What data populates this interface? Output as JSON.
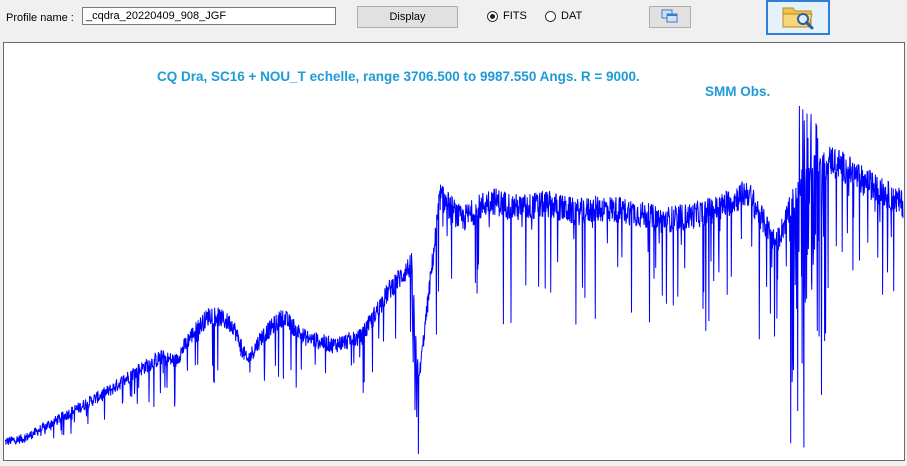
{
  "form": {
    "profile_label": "Profile name :",
    "profile_value": "_cqdra_20220409_908_JGF",
    "display_label": "Display",
    "format_options": [
      {
        "label": "FITS",
        "selected": true
      },
      {
        "label": "DAT",
        "selected": false
      }
    ]
  },
  "icons": {
    "copy": "copy-windows-icon",
    "open": "folder-magnifier-icon"
  },
  "colors": {
    "spectrum": "#0000ff",
    "title": "#1e9bd7",
    "focus_border": "#2f7fd6"
  },
  "chart_data": {
    "type": "line",
    "title": "CQ Dra, SC16 + NOU_T echelle, range 3706.500 to 9987.550 Angs. R = 9000.",
    "observatory": "SMM Obs.",
    "xlabel": "",
    "ylabel": "",
    "xlim": [
      3706.5,
      9987.55
    ],
    "grid": false,
    "series": [
      {
        "x": [
          3706.5,
          3850,
          4000,
          4150,
          4300,
          4450,
          4600,
          4800,
          4900,
          5000,
          5150,
          5300,
          5400,
          5500,
          5650,
          5800,
          6000,
          6200,
          6400,
          6550,
          6600,
          6750,
          6900,
          7100,
          7300,
          7500,
          7700,
          7900,
          8100,
          8300,
          8500,
          8700,
          8900,
          9100,
          9300,
          9500,
          9700,
          9987.55
        ],
        "y": [
          0.03,
          0.04,
          0.07,
          0.1,
          0.13,
          0.16,
          0.2,
          0.24,
          0.23,
          0.29,
          0.35,
          0.32,
          0.23,
          0.29,
          0.34,
          0.29,
          0.27,
          0.29,
          0.41,
          0.47,
          0.18,
          0.64,
          0.58,
          0.63,
          0.61,
          0.62,
          0.6,
          0.61,
          0.6,
          0.58,
          0.59,
          0.61,
          0.65,
          0.52,
          0.7,
          0.73,
          0.68,
          0.62
        ]
      }
    ]
  }
}
